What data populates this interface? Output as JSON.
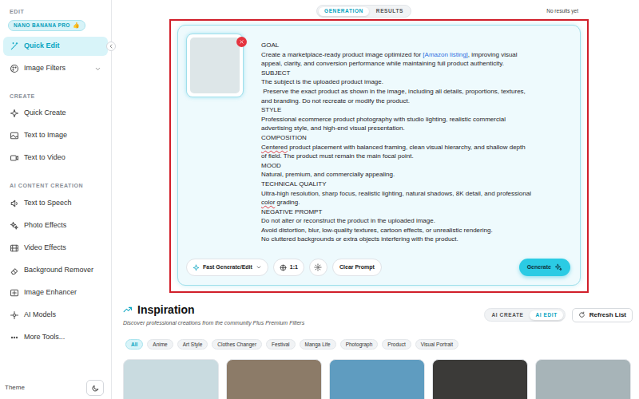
{
  "sidebar": {
    "sections": [
      {
        "heading": "EDIT",
        "badge": {
          "text": "NANO BANANA PRO",
          "emoji": "👍"
        },
        "items": [
          {
            "label": "Quick Edit",
            "selected": true,
            "kind": "link"
          },
          {
            "label": "Image Filters",
            "selected": false,
            "kind": "group"
          }
        ]
      },
      {
        "heading": "CREATE",
        "items": [
          {
            "label": "Quick Create",
            "selected": false,
            "kind": "link"
          },
          {
            "label": "Text to Image",
            "selected": false,
            "kind": "link"
          },
          {
            "label": "Text to Video",
            "selected": false,
            "kind": "link"
          }
        ]
      },
      {
        "heading": "AI CONTENT CREATION",
        "items": [
          {
            "label": "Text to Speech",
            "selected": false,
            "kind": "link"
          },
          {
            "label": "Photo Effects",
            "selected": false,
            "kind": "link"
          },
          {
            "label": "Video Effects",
            "selected": false,
            "kind": "link"
          },
          {
            "label": "Background Remover",
            "selected": false,
            "kind": "link"
          },
          {
            "label": "Image Enhancer",
            "selected": false,
            "kind": "link"
          },
          {
            "label": "AI Models",
            "selected": false,
            "kind": "link"
          },
          {
            "label": "More Tools...",
            "selected": false,
            "kind": "link"
          }
        ]
      }
    ],
    "theme_label": "Theme"
  },
  "tabs": [
    {
      "label": "GENERATION",
      "selected": true
    },
    {
      "label": "RESULTS",
      "selected": false
    }
  ],
  "results_status": "No results yet",
  "prompt": {
    "lines": [
      [
        {
          "text": "GOAL",
          "link": false,
          "misspelled": false
        }
      ],
      [
        {
          "text": "Create a marketplace-ready product image optimized for ",
          "link": false,
          "misspelled": false
        },
        {
          "text": "[Amazon listing]",
          "link": true,
          "misspelled": false
        },
        {
          "text": ", improving visual",
          "link": false,
          "misspelled": false
        }
      ],
      [
        {
          "text": "appeal, clarity, and conversion performance while maintaining full product authenticity.",
          "link": false,
          "misspelled": false
        }
      ],
      [
        {
          "text": "SUBJECT",
          "link": false,
          "misspelled": false
        }
      ],
      [
        {
          "text": "The subject is the uploaded product image.",
          "link": false,
          "misspelled": false
        }
      ],
      [
        {
          "text": " Preserve the exact product as shown in the image, including all details, proportions, textures,",
          "link": false,
          "misspelled": false
        }
      ],
      [
        {
          "text": "and branding. Do not recreate or modify the product.",
          "link": false,
          "misspelled": false
        }
      ],
      [
        {
          "text": "STYLE",
          "link": false,
          "misspelled": false
        }
      ],
      [
        {
          "text": "Professional ecommerce product photography with studio lighting, realistic commercial",
          "link": false,
          "misspelled": false
        }
      ],
      [
        {
          "text": "advertising style, and high-end visual presentation.",
          "link": false,
          "misspelled": false
        }
      ],
      [
        {
          "text": "COMPOSITION",
          "link": false,
          "misspelled": false
        }
      ],
      [
        {
          "text": "Centered",
          "link": false,
          "misspelled": true
        },
        {
          "text": " product placement with balanced framing, clean visual hierarchy, and shallow depth",
          "link": false,
          "misspelled": false
        }
      ],
      [
        {
          "text": "of field. The product must remain the main focal point.",
          "link": false,
          "misspelled": false
        }
      ],
      [
        {
          "text": "MOOD",
          "link": false,
          "misspelled": false
        }
      ],
      [
        {
          "text": "Natural, premium, and commercially appealing.",
          "link": false,
          "misspelled": false
        }
      ],
      [
        {
          "text": "TECHNICAL QUALITY",
          "link": false,
          "misspelled": false
        }
      ],
      [
        {
          "text": "Ultra-high resolution, sharp focus, realistic lighting, natural shadows, 8K detail, and professional",
          "link": false,
          "misspelled": false
        }
      ],
      [
        {
          "text": "color",
          "link": false,
          "misspelled": true
        },
        {
          "text": " grading.",
          "link": false,
          "misspelled": false
        }
      ],
      [
        {
          "text": "NEGATIVE PROMPT",
          "link": false,
          "misspelled": false
        }
      ],
      [
        {
          "text": "Do not alter or reconstruct the product in the uploaded image.",
          "link": false,
          "misspelled": false
        }
      ],
      [
        {
          "text": "Avoid distortion, blur, low-quality textures, cartoon effects, or unrealistic rendering.",
          "link": false,
          "misspelled": false
        }
      ],
      [
        {
          "text": "No cluttered backgrounds or extra objects interfering with the product.",
          "link": false,
          "misspelled": false
        }
      ]
    ]
  },
  "toolbar": {
    "mode": "Fast Generate/Edit",
    "ratio": "1:1",
    "clear": "Clear Prompt",
    "generate": "Generate"
  },
  "inspiration": {
    "title": "Inspiration",
    "subtitle": "Discover professional creations from the community Plus Premium Filters",
    "toggle": [
      {
        "label": "AI CREATE",
        "selected": false
      },
      {
        "label": "AI EDIT",
        "selected": true
      }
    ],
    "refresh": "Refresh List",
    "filters": [
      {
        "label": "All",
        "selected": true
      },
      {
        "label": "Anime",
        "selected": false
      },
      {
        "label": "Art Style",
        "selected": false
      },
      {
        "label": "Clothes Changer",
        "selected": false
      },
      {
        "label": "Festival",
        "selected": false
      },
      {
        "label": "Manga Life",
        "selected": false
      },
      {
        "label": "Photograph",
        "selected": false
      },
      {
        "label": "Product",
        "selected": false
      },
      {
        "label": "Visual Portrait",
        "selected": false
      }
    ],
    "cards": [
      {
        "color": "#c9dbe0"
      },
      {
        "color": "#8c7b68"
      },
      {
        "color": "#5f9cc0"
      },
      {
        "color": "#3b3a38"
      },
      {
        "color": "#a7b4b8"
      }
    ]
  }
}
